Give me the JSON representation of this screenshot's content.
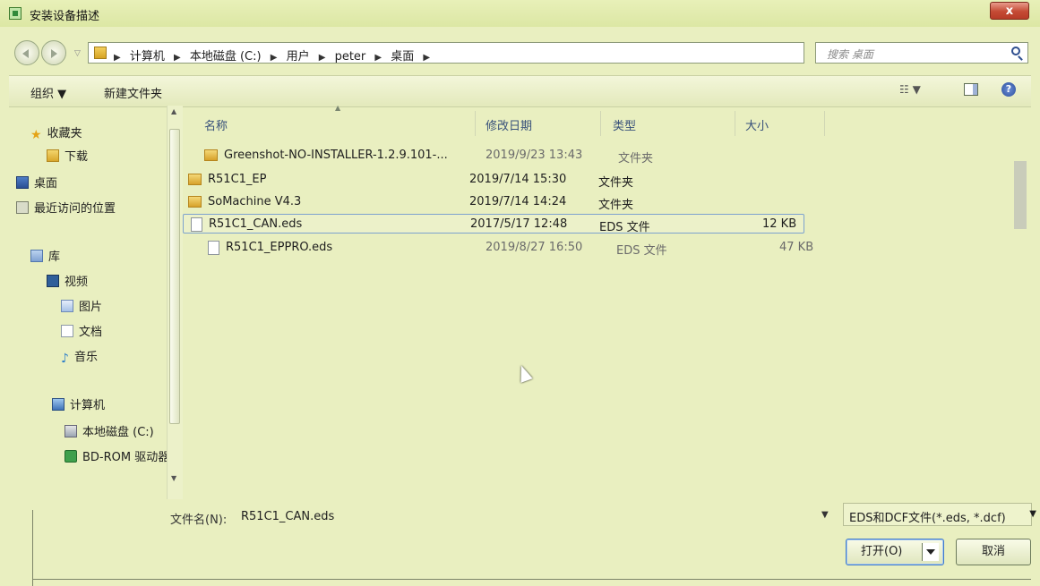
{
  "window": {
    "title": "安装设备描述",
    "close_label": "x"
  },
  "address_bar": {
    "crumbs": [
      "计算机",
      "本地磁盘 (C:)",
      "用户",
      "peter",
      "桌面"
    ],
    "search_placeholder": "搜索 桌面"
  },
  "toolbar": {
    "organize_label": "组织 ▼",
    "new_folder_label": "新建文件夹",
    "view_label": "☷ ▼",
    "help_label": "?"
  },
  "sidebar": {
    "favorites_label": "收藏夹",
    "downloads_label": "下载",
    "desktop_label": "桌面",
    "recent_label": "最近访问的位置",
    "libraries_label": "库",
    "videos_label": "视频",
    "pictures_label": "图片",
    "documents_label": "文档",
    "music_label": "音乐",
    "computer_label": "计算机",
    "local_disk_label": "本地磁盘 (C:)",
    "bdrom_label": "BD-ROM 驱动器"
  },
  "columns": {
    "name": "名称",
    "modified": "修改日期",
    "type": "类型",
    "size": "大小"
  },
  "files": [
    {
      "name": "Greenshot-NO-INSTALLER-1.2.9.101-...",
      "modified": "2019/9/23 13:43",
      "type": "文件夹",
      "size": "",
      "kind": "folder"
    },
    {
      "name": "R51C1_EP",
      "modified": "2019/7/14 15:30",
      "type": "文件夹",
      "size": "",
      "kind": "folder"
    },
    {
      "name": "SoMachine V4.3",
      "modified": "2019/7/14 14:24",
      "type": "文件夹",
      "size": "",
      "kind": "folder"
    },
    {
      "name": "R51C1_CAN.eds",
      "modified": "2017/5/17 12:48",
      "type": "EDS 文件",
      "size": "12 KB",
      "kind": "file"
    },
    {
      "name": "R51C1_EPPRO.eds",
      "modified": "2019/8/27 16:50",
      "type": "EDS 文件",
      "size": "47 KB",
      "kind": "file"
    }
  ],
  "bottom": {
    "filename_label": "文件名(N):",
    "filename_value": "R51C1_CAN.eds",
    "filter_value": "EDS和DCF文件(*.eds, *.dcf)",
    "open_label": "打开(O)",
    "cancel_label": "取消"
  },
  "colors": {
    "window_bg": "#e9efc0",
    "selection_border": "#7da2ce"
  }
}
